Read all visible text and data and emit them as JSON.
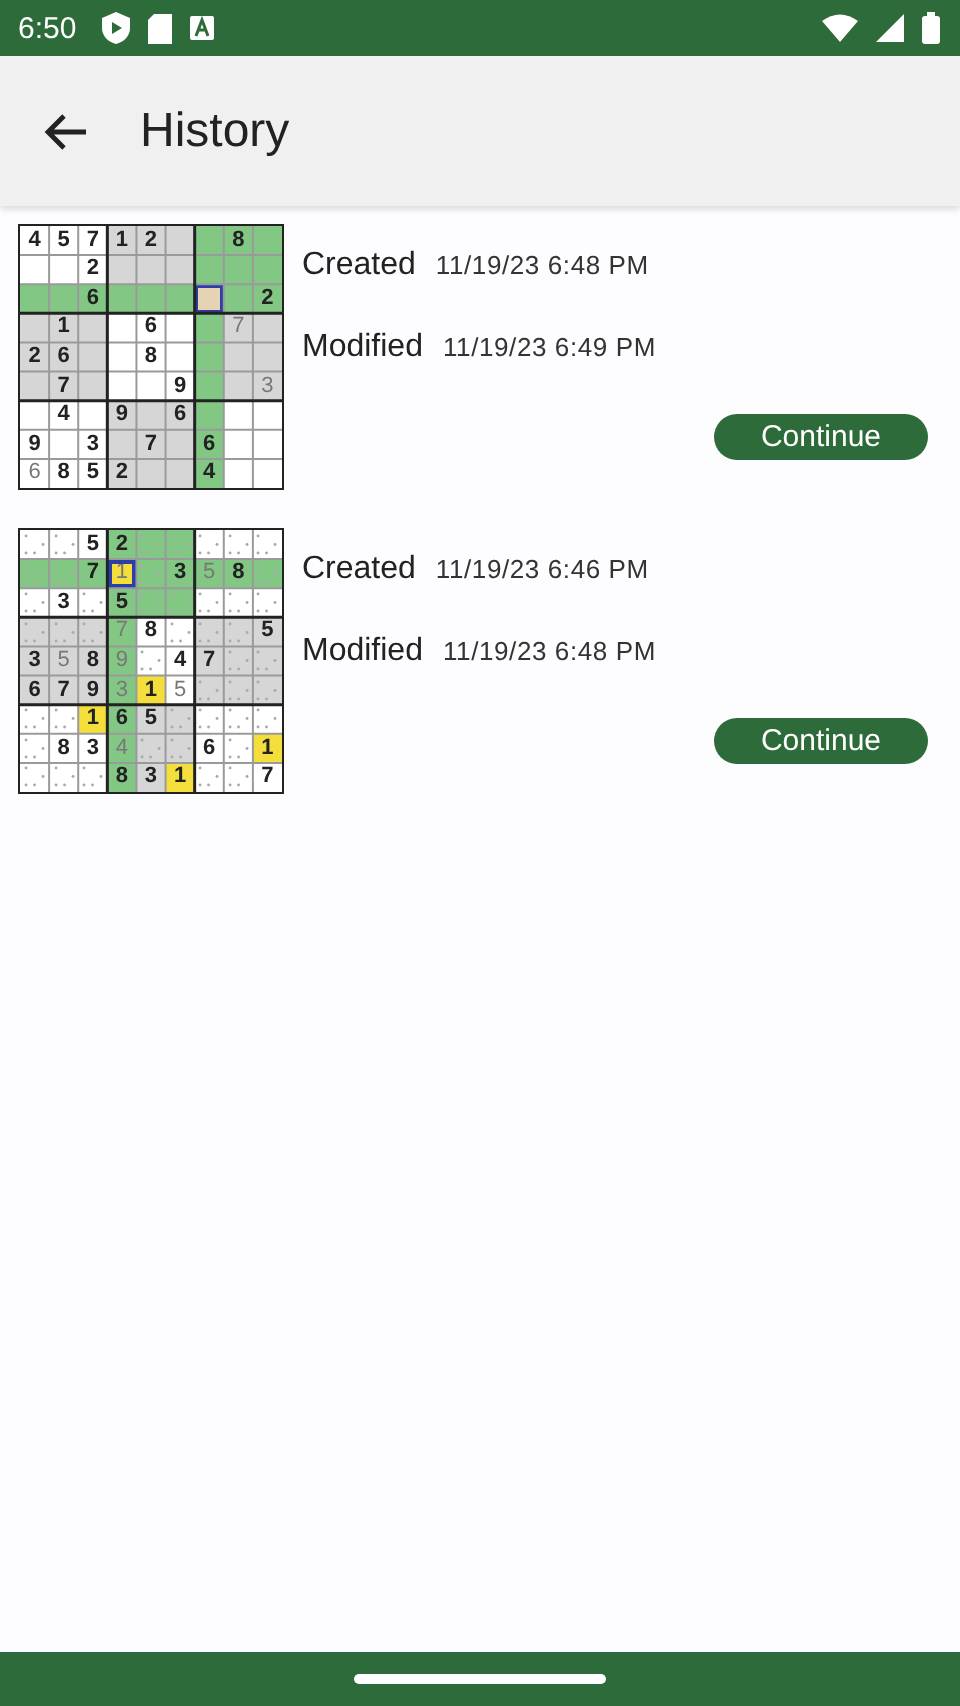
{
  "status_bar": {
    "time": "6:50"
  },
  "app_bar": {
    "title": "History"
  },
  "games": [
    {
      "created_label": "Created",
      "created": "11/19/23 6:48 PM",
      "modified_label": "Modified",
      "modified": "11/19/23 6:49 PM",
      "button": "Continue",
      "notes": false,
      "rows": [
        [
          {
            "kind": "given",
            "value": "4",
            "color": "#ffffff",
            "selected": false
          },
          {
            "kind": "given",
            "value": "5",
            "color": "#ffffff",
            "selected": false
          },
          {
            "kind": "given",
            "value": "7",
            "color": "#ffffff",
            "selected": false
          },
          {
            "kind": "given",
            "value": "1",
            "color": "#d6d6d6",
            "selected": false
          },
          {
            "kind": "given",
            "value": "2",
            "color": "#d6d6d6",
            "selected": false
          },
          {
            "kind": "empty",
            "color": "#d6d6d6",
            "selected": false
          },
          {
            "kind": "empty",
            "color": "#82c784",
            "selected": false
          },
          {
            "kind": "given",
            "value": "8",
            "color": "#82c784",
            "selected": false
          },
          {
            "kind": "empty",
            "color": "#82c784",
            "selected": false
          }
        ],
        [
          {
            "kind": "empty",
            "color": "#ffffff",
            "selected": false
          },
          {
            "kind": "empty",
            "color": "#ffffff",
            "selected": false
          },
          {
            "kind": "given",
            "value": "2",
            "color": "#ffffff",
            "selected": false
          },
          {
            "kind": "empty",
            "color": "#d6d6d6",
            "selected": false
          },
          {
            "kind": "empty",
            "color": "#d6d6d6",
            "selected": false
          },
          {
            "kind": "empty",
            "color": "#d6d6d6",
            "selected": false
          },
          {
            "kind": "empty",
            "color": "#82c784",
            "selected": false
          },
          {
            "kind": "empty",
            "color": "#82c784",
            "selected": false
          },
          {
            "kind": "empty",
            "color": "#82c784",
            "selected": false
          }
        ],
        [
          {
            "kind": "empty",
            "color": "#82c784",
            "selected": false
          },
          {
            "kind": "empty",
            "color": "#82c784",
            "selected": false
          },
          {
            "kind": "given",
            "value": "6",
            "color": "#82c784",
            "selected": false
          },
          {
            "kind": "empty",
            "color": "#82c784",
            "selected": false
          },
          {
            "kind": "empty",
            "color": "#82c784",
            "selected": false
          },
          {
            "kind": "empty",
            "color": "#82c784",
            "selected": false
          },
          {
            "kind": "empty",
            "color": "#e6d3b3",
            "selected": true
          },
          {
            "kind": "empty",
            "color": "#82c784",
            "selected": false
          },
          {
            "kind": "given",
            "value": "2",
            "color": "#82c784",
            "selected": false
          }
        ],
        [
          {
            "kind": "empty",
            "color": "#d6d6d6",
            "selected": false
          },
          {
            "kind": "given",
            "value": "1",
            "color": "#d6d6d6",
            "selected": false
          },
          {
            "kind": "empty",
            "color": "#d6d6d6",
            "selected": false
          },
          {
            "kind": "empty",
            "color": "#ffffff",
            "selected": false
          },
          {
            "kind": "given",
            "value": "6",
            "color": "#ffffff",
            "selected": false
          },
          {
            "kind": "empty",
            "color": "#ffffff",
            "selected": false
          },
          {
            "kind": "empty",
            "color": "#82c784",
            "selected": false
          },
          {
            "kind": "entered",
            "value": "7",
            "color": "#d6d6d6",
            "selected": false
          },
          {
            "kind": "empty",
            "color": "#d6d6d6",
            "selected": false
          }
        ],
        [
          {
            "kind": "given",
            "value": "2",
            "color": "#d6d6d6",
            "selected": false
          },
          {
            "kind": "given",
            "value": "6",
            "color": "#d6d6d6",
            "selected": false
          },
          {
            "kind": "empty",
            "color": "#d6d6d6",
            "selected": false
          },
          {
            "kind": "empty",
            "color": "#ffffff",
            "selected": false
          },
          {
            "kind": "given",
            "value": "8",
            "color": "#ffffff",
            "selected": false
          },
          {
            "kind": "empty",
            "color": "#ffffff",
            "selected": false
          },
          {
            "kind": "empty",
            "color": "#82c784",
            "selected": false
          },
          {
            "kind": "empty",
            "color": "#d6d6d6",
            "selected": false
          },
          {
            "kind": "empty",
            "color": "#d6d6d6",
            "selected": false
          }
        ],
        [
          {
            "kind": "empty",
            "color": "#d6d6d6",
            "selected": false
          },
          {
            "kind": "given",
            "value": "7",
            "color": "#d6d6d6",
            "selected": false
          },
          {
            "kind": "empty",
            "color": "#d6d6d6",
            "selected": false
          },
          {
            "kind": "empty",
            "color": "#ffffff",
            "selected": false
          },
          {
            "kind": "empty",
            "color": "#ffffff",
            "selected": false
          },
          {
            "kind": "given",
            "value": "9",
            "color": "#ffffff",
            "selected": false
          },
          {
            "kind": "empty",
            "color": "#82c784",
            "selected": false
          },
          {
            "kind": "empty",
            "color": "#d6d6d6",
            "selected": false
          },
          {
            "kind": "entered",
            "value": "3",
            "color": "#d6d6d6",
            "selected": false
          }
        ],
        [
          {
            "kind": "empty",
            "color": "#ffffff",
            "selected": false
          },
          {
            "kind": "given",
            "value": "4",
            "color": "#ffffff",
            "selected": false
          },
          {
            "kind": "empty",
            "color": "#ffffff",
            "selected": false
          },
          {
            "kind": "given",
            "value": "9",
            "color": "#d6d6d6",
            "selected": false
          },
          {
            "kind": "empty",
            "color": "#d6d6d6",
            "selected": false
          },
          {
            "kind": "given",
            "value": "6",
            "color": "#d6d6d6",
            "selected": false
          },
          {
            "kind": "empty",
            "color": "#82c784",
            "selected": false
          },
          {
            "kind": "empty",
            "color": "#ffffff",
            "selected": false
          },
          {
            "kind": "empty",
            "color": "#ffffff",
            "selected": false
          }
        ],
        [
          {
            "kind": "given",
            "value": "9",
            "color": "#ffffff",
            "selected": false
          },
          {
            "kind": "empty",
            "color": "#ffffff",
            "selected": false
          },
          {
            "kind": "given",
            "value": "3",
            "color": "#ffffff",
            "selected": false
          },
          {
            "kind": "empty",
            "color": "#d6d6d6",
            "selected": false
          },
          {
            "kind": "given",
            "value": "7",
            "color": "#d6d6d6",
            "selected": false
          },
          {
            "kind": "empty",
            "color": "#d6d6d6",
            "selected": false
          },
          {
            "kind": "given",
            "value": "6",
            "color": "#82c784",
            "selected": false
          },
          {
            "kind": "empty",
            "color": "#ffffff",
            "selected": false
          },
          {
            "kind": "empty",
            "color": "#ffffff",
            "selected": false
          }
        ],
        [
          {
            "kind": "entered",
            "value": "6",
            "color": "#ffffff",
            "selected": false
          },
          {
            "kind": "given",
            "value": "8",
            "color": "#ffffff",
            "selected": false
          },
          {
            "kind": "given",
            "value": "5",
            "color": "#ffffff",
            "selected": false
          },
          {
            "kind": "given",
            "value": "2",
            "color": "#d6d6d6",
            "selected": false
          },
          {
            "kind": "empty",
            "color": "#d6d6d6",
            "selected": false
          },
          {
            "kind": "empty",
            "color": "#d6d6d6",
            "selected": false
          },
          {
            "kind": "given",
            "value": "4",
            "color": "#82c784",
            "selected": false
          },
          {
            "kind": "empty",
            "color": "#ffffff",
            "selected": false
          },
          {
            "kind": "empty",
            "color": "#ffffff",
            "selected": false
          }
        ]
      ]
    },
    {
      "created_label": "Created",
      "created": "11/19/23 6:46 PM",
      "modified_label": "Modified",
      "modified": "11/19/23 6:48 PM",
      "button": "Continue",
      "notes": true,
      "rows": [
        [
          {
            "kind": "empty",
            "color": "#ffffff",
            "selected": false
          },
          {
            "kind": "empty",
            "color": "#ffffff",
            "selected": false
          },
          {
            "kind": "given",
            "value": "5",
            "color": "#ffffff",
            "selected": false
          },
          {
            "kind": "given",
            "value": "2",
            "color": "#82c784",
            "selected": false
          },
          {
            "kind": "empty",
            "color": "#82c784",
            "selected": false
          },
          {
            "kind": "empty",
            "color": "#82c784",
            "selected": false
          },
          {
            "kind": "empty",
            "color": "#ffffff",
            "selected": false
          },
          {
            "kind": "empty",
            "color": "#ffffff",
            "selected": false
          },
          {
            "kind": "empty",
            "color": "#ffffff",
            "selected": false
          }
        ],
        [
          {
            "kind": "empty",
            "color": "#82c784",
            "selected": false
          },
          {
            "kind": "empty",
            "color": "#82c784",
            "selected": false
          },
          {
            "kind": "given",
            "value": "7",
            "color": "#82c784",
            "selected": false
          },
          {
            "kind": "entered",
            "value": "1",
            "color": "#f4de3c",
            "selected": true
          },
          {
            "kind": "empty",
            "color": "#82c784",
            "selected": false
          },
          {
            "kind": "given",
            "value": "3",
            "color": "#82c784",
            "selected": false
          },
          {
            "kind": "entered",
            "value": "5",
            "color": "#82c784",
            "selected": false
          },
          {
            "kind": "given",
            "value": "8",
            "color": "#82c784",
            "selected": false
          },
          {
            "kind": "empty",
            "color": "#82c784",
            "selected": false
          }
        ],
        [
          {
            "kind": "empty",
            "color": "#ffffff",
            "selected": false
          },
          {
            "kind": "given",
            "value": "3",
            "color": "#ffffff",
            "selected": false
          },
          {
            "kind": "empty",
            "color": "#ffffff",
            "selected": false
          },
          {
            "kind": "given",
            "value": "5",
            "color": "#82c784",
            "selected": false
          },
          {
            "kind": "empty",
            "color": "#82c784",
            "selected": false
          },
          {
            "kind": "empty",
            "color": "#82c784",
            "selected": false
          },
          {
            "kind": "empty",
            "color": "#ffffff",
            "selected": false
          },
          {
            "kind": "empty",
            "color": "#ffffff",
            "selected": false
          },
          {
            "kind": "empty",
            "color": "#ffffff",
            "selected": false
          }
        ],
        [
          {
            "kind": "empty",
            "color": "#d6d6d6",
            "selected": false
          },
          {
            "kind": "empty",
            "color": "#d6d6d6",
            "selected": false
          },
          {
            "kind": "empty",
            "color": "#d6d6d6",
            "selected": false
          },
          {
            "kind": "entered",
            "value": "7",
            "color": "#82c784",
            "selected": false
          },
          {
            "kind": "given",
            "value": "8",
            "color": "#ffffff",
            "selected": false
          },
          {
            "kind": "empty",
            "color": "#ffffff",
            "selected": false
          },
          {
            "kind": "empty",
            "color": "#d6d6d6",
            "selected": false
          },
          {
            "kind": "empty",
            "color": "#d6d6d6",
            "selected": false
          },
          {
            "kind": "given",
            "value": "5",
            "color": "#d6d6d6",
            "selected": false
          }
        ],
        [
          {
            "kind": "given",
            "value": "3",
            "color": "#d6d6d6",
            "selected": false
          },
          {
            "kind": "entered",
            "value": "5",
            "color": "#d6d6d6",
            "selected": false
          },
          {
            "kind": "given",
            "value": "8",
            "color": "#d6d6d6",
            "selected": false
          },
          {
            "kind": "entered",
            "value": "9",
            "color": "#82c784",
            "selected": false
          },
          {
            "kind": "empty",
            "color": "#ffffff",
            "selected": false
          },
          {
            "kind": "given",
            "value": "4",
            "color": "#ffffff",
            "selected": false
          },
          {
            "kind": "given",
            "value": "7",
            "color": "#d6d6d6",
            "selected": false
          },
          {
            "kind": "empty",
            "color": "#d6d6d6",
            "selected": false
          },
          {
            "kind": "empty",
            "color": "#d6d6d6",
            "selected": false
          }
        ],
        [
          {
            "kind": "given",
            "value": "6",
            "color": "#d6d6d6",
            "selected": false
          },
          {
            "kind": "given",
            "value": "7",
            "color": "#d6d6d6",
            "selected": false
          },
          {
            "kind": "given",
            "value": "9",
            "color": "#d6d6d6",
            "selected": false
          },
          {
            "kind": "entered",
            "value": "3",
            "color": "#82c784",
            "selected": false
          },
          {
            "kind": "given",
            "value": "1",
            "color": "#f4de3c",
            "selected": false
          },
          {
            "kind": "entered",
            "value": "5",
            "color": "#ffffff",
            "selected": false
          },
          {
            "kind": "empty",
            "color": "#d6d6d6",
            "selected": false
          },
          {
            "kind": "empty",
            "color": "#d6d6d6",
            "selected": false
          },
          {
            "kind": "empty",
            "color": "#d6d6d6",
            "selected": false
          }
        ],
        [
          {
            "kind": "empty",
            "color": "#ffffff",
            "selected": false
          },
          {
            "kind": "empty",
            "color": "#ffffff",
            "selected": false
          },
          {
            "kind": "given",
            "value": "1",
            "color": "#f4de3c",
            "selected": false
          },
          {
            "kind": "given",
            "value": "6",
            "color": "#82c784",
            "selected": false
          },
          {
            "kind": "given",
            "value": "5",
            "color": "#d6d6d6",
            "selected": false
          },
          {
            "kind": "empty",
            "color": "#d6d6d6",
            "selected": false
          },
          {
            "kind": "empty",
            "color": "#ffffff",
            "selected": false
          },
          {
            "kind": "empty",
            "color": "#ffffff",
            "selected": false
          },
          {
            "kind": "empty",
            "color": "#ffffff",
            "selected": false
          }
        ],
        [
          {
            "kind": "empty",
            "color": "#ffffff",
            "selected": false
          },
          {
            "kind": "given",
            "value": "8",
            "color": "#ffffff",
            "selected": false
          },
          {
            "kind": "given",
            "value": "3",
            "color": "#ffffff",
            "selected": false
          },
          {
            "kind": "entered",
            "value": "4",
            "color": "#82c784",
            "selected": false
          },
          {
            "kind": "empty",
            "color": "#d6d6d6",
            "selected": false
          },
          {
            "kind": "empty",
            "color": "#d6d6d6",
            "selected": false
          },
          {
            "kind": "given",
            "value": "6",
            "color": "#ffffff",
            "selected": false
          },
          {
            "kind": "empty",
            "color": "#ffffff",
            "selected": false
          },
          {
            "kind": "given",
            "value": "1",
            "color": "#f4de3c",
            "selected": false
          }
        ],
        [
          {
            "kind": "empty",
            "color": "#ffffff",
            "selected": false
          },
          {
            "kind": "empty",
            "color": "#ffffff",
            "selected": false
          },
          {
            "kind": "empty",
            "color": "#ffffff",
            "selected": false
          },
          {
            "kind": "given",
            "value": "8",
            "color": "#82c784",
            "selected": false
          },
          {
            "kind": "given",
            "value": "3",
            "color": "#d6d6d6",
            "selected": false
          },
          {
            "kind": "given",
            "value": "1",
            "color": "#f4de3c",
            "selected": false
          },
          {
            "kind": "empty",
            "color": "#ffffff",
            "selected": false
          },
          {
            "kind": "empty",
            "color": "#ffffff",
            "selected": false
          },
          {
            "kind": "given",
            "value": "7",
            "color": "#ffffff",
            "selected": false
          }
        ]
      ]
    }
  ]
}
